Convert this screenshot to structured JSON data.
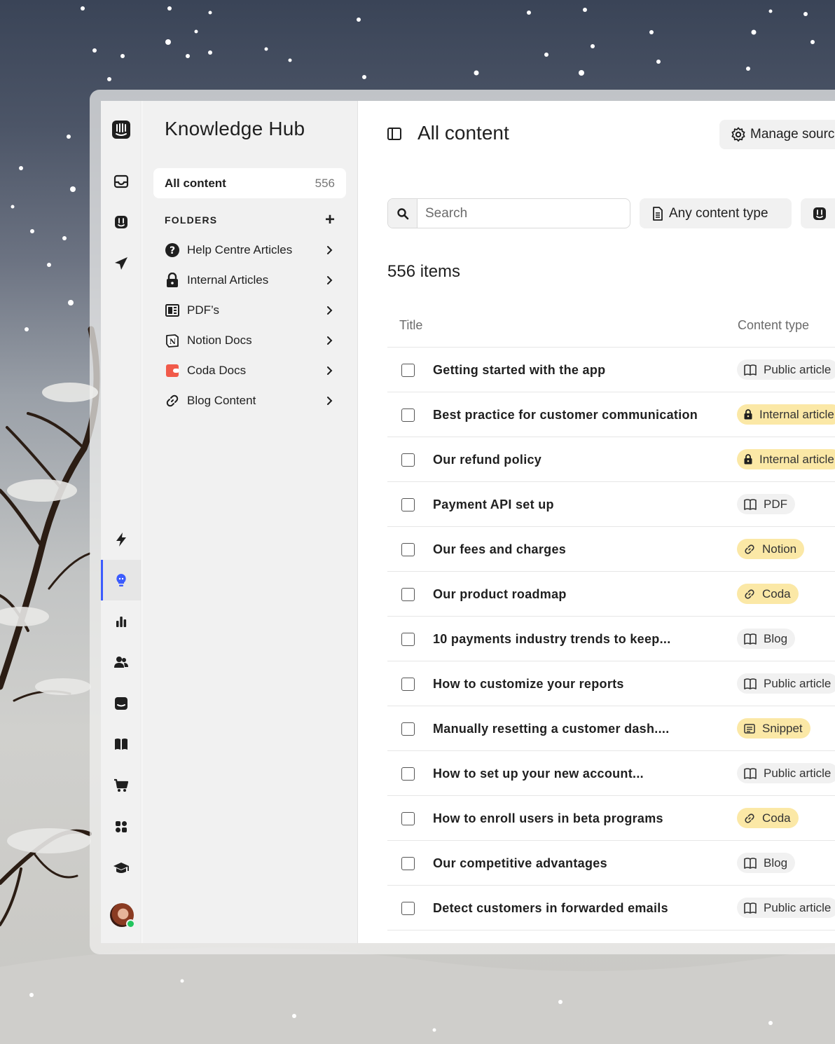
{
  "sidebar": {
    "title": "Knowledge Hub",
    "all_content": {
      "label": "All content",
      "count": "556"
    },
    "folders_heading": "FOLDERS",
    "folders": [
      {
        "label": "Help Centre Articles",
        "icon": "question-circle-icon"
      },
      {
        "label": "Internal Articles",
        "icon": "lock-icon"
      },
      {
        "label": "PDF’s",
        "icon": "pdf-icon"
      },
      {
        "label": "Notion Docs",
        "icon": "notion-icon"
      },
      {
        "label": "Coda Docs",
        "icon": "coda-icon"
      },
      {
        "label": "Blog Content",
        "icon": "link-icon"
      }
    ]
  },
  "main": {
    "title": "All content",
    "manage_sources_label": "Manage sources",
    "search_placeholder": "Search",
    "content_type_filter": "Any content type",
    "items_count": "556 items",
    "columns": {
      "title": "Title",
      "content_type": "Content type"
    },
    "rows": [
      {
        "title": "Getting started with the app",
        "type": "Public article",
        "badge": "grey",
        "icon": "book-icon"
      },
      {
        "title": "Best practice for customer communication",
        "type": "Internal article",
        "badge": "yellow",
        "icon": "lock-icon"
      },
      {
        "title": "Our refund policy",
        "type": "Internal article",
        "badge": "yellow",
        "icon": "lock-icon"
      },
      {
        "title": "Payment API set up",
        "type": "PDF",
        "badge": "grey",
        "icon": "book-icon"
      },
      {
        "title": "Our fees and charges",
        "type": "Notion",
        "badge": "yellow",
        "icon": "link-icon"
      },
      {
        "title": "Our product roadmap",
        "type": "Coda",
        "badge": "yellow",
        "icon": "link-icon"
      },
      {
        "title": "10 payments industry trends to keep...",
        "type": "Blog",
        "badge": "grey",
        "icon": "book-icon"
      },
      {
        "title": "How to customize your reports",
        "type": "Public article",
        "badge": "grey",
        "icon": "book-icon"
      },
      {
        "title": "Manually resetting a customer dash....",
        "type": "Snippet",
        "badge": "yellow",
        "icon": "snippet-icon"
      },
      {
        "title": "How to set up your new account...",
        "type": "Public article",
        "badge": "grey",
        "icon": "book-icon"
      },
      {
        "title": "How to enroll users in beta programs",
        "type": "Coda",
        "badge": "yellow",
        "icon": "link-icon"
      },
      {
        "title": "Our competitive advantages",
        "type": "Blog",
        "badge": "grey",
        "icon": "book-icon"
      },
      {
        "title": "Detect customers in forwarded emails",
        "type": "Public article",
        "badge": "grey",
        "icon": "book-icon"
      }
    ]
  },
  "rail_icons": [
    "app-logo-icon",
    "inbox-icon",
    "fin-bot-icon",
    "send-icon",
    "bolt-icon",
    "lightbulb-icon",
    "reports-icon",
    "contacts-icon",
    "messenger-icon",
    "book-icon",
    "cart-icon",
    "apps-icon",
    "academy-icon"
  ],
  "colors": {
    "accent": "#3b5bfd",
    "badge_yellow": "#fbe8a6",
    "badge_grey": "#f1f1f1",
    "online": "#22c55e"
  }
}
